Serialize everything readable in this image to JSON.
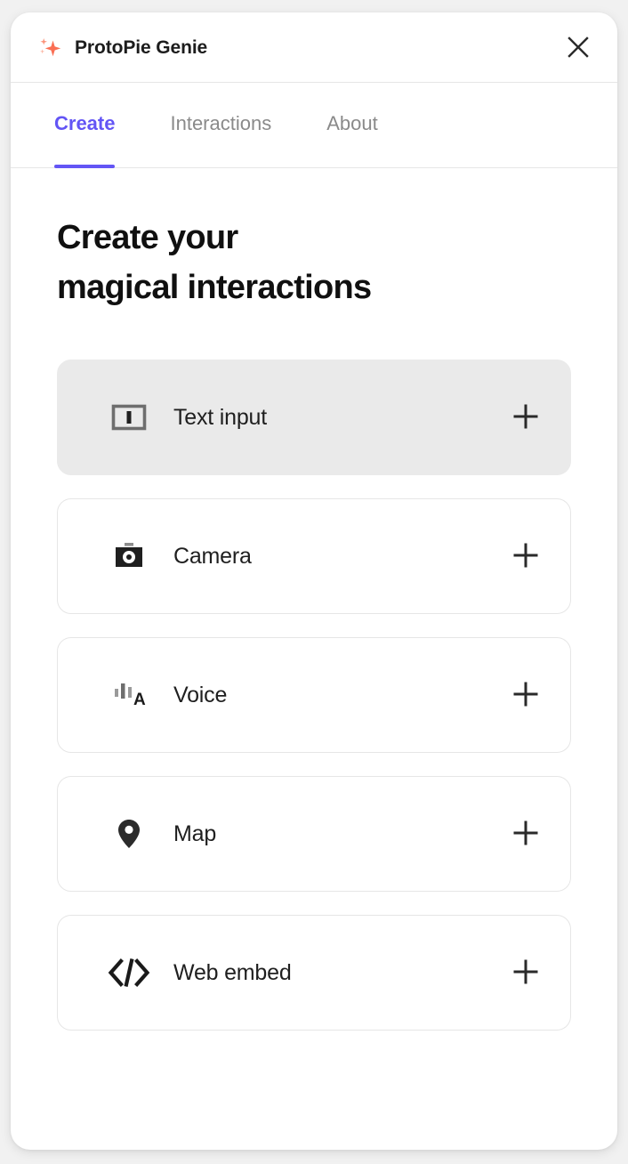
{
  "window": {
    "brand_title": "ProtoPie Genie",
    "brand_icon": "sparkle-icon",
    "close_icon": "close-icon",
    "accent_color": "#6355F5",
    "brand_icon_color": "#FA7055",
    "highlight_color": "#EAEAEA"
  },
  "tabs": [
    {
      "label": "Create",
      "active": true
    },
    {
      "label": "Interactions",
      "active": false
    },
    {
      "label": "About",
      "active": false
    }
  ],
  "main": {
    "headline_line1": "Create your",
    "headline_line2": "magical interactions",
    "cards": [
      {
        "label": "Text input",
        "icon": "text-input-icon",
        "add_icon": "plus-icon",
        "highlighted": true
      },
      {
        "label": "Camera",
        "icon": "camera-icon",
        "add_icon": "plus-icon",
        "highlighted": false
      },
      {
        "label": "Voice",
        "icon": "voice-icon",
        "add_icon": "plus-icon",
        "highlighted": false
      },
      {
        "label": "Map",
        "icon": "map-pin-icon",
        "add_icon": "plus-icon",
        "highlighted": false
      },
      {
        "label": "Web embed",
        "icon": "web-embed-icon",
        "add_icon": "plus-icon",
        "highlighted": false
      }
    ]
  }
}
